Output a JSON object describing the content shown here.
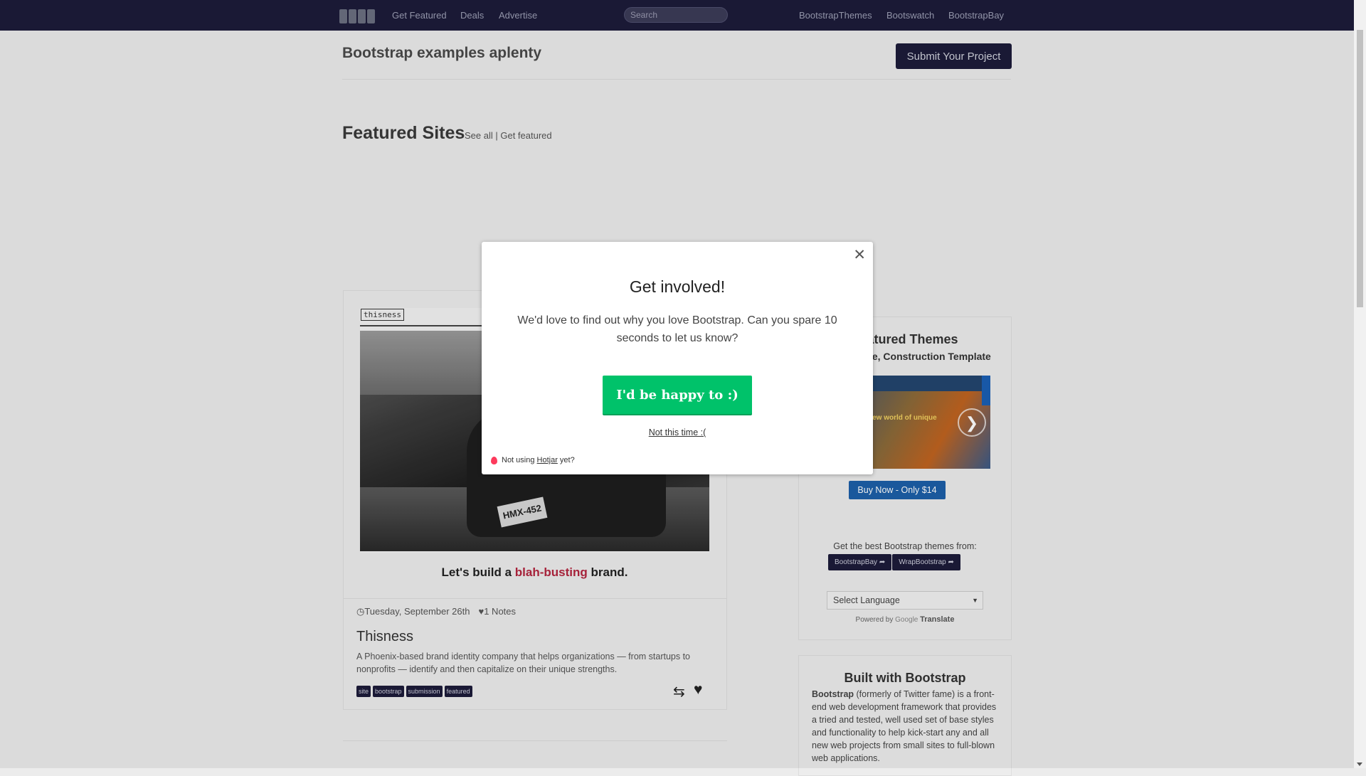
{
  "nav": {
    "links": [
      "Get Featured",
      "Deals",
      "Advertise"
    ],
    "search_placeholder": "Search",
    "right_links": [
      "BootstrapThemes",
      "Bootswatch",
      "BootstrapBay"
    ]
  },
  "header": {
    "title": "Bootstrap examples aplenty",
    "submit_label": "Submit Your Project"
  },
  "featured": {
    "title": "Featured Sites",
    "links": "See all | Get featured"
  },
  "post": {
    "thumb_tag": "thisness",
    "tagline_pre": "Let's build a ",
    "tagline_hl": "blah-busting",
    "tagline_post": " brand.",
    "plate": "HMX-452",
    "date": "Tuesday, September 26th",
    "notes": "1 Notes",
    "title": "Thisness",
    "description": "A Phoenix-based brand identity company that helps organizations — from startups to nonprofits — identify and then capitalize on their unique strengths.",
    "tags": [
      "site",
      "bootstrap",
      "submission",
      "featured"
    ]
  },
  "sidebar": {
    "heading": "Featured Themes",
    "subheading": "Architecture, Construction Template",
    "theme_img_text": "new world of unique",
    "buy_label": "Buy Now - Only $14",
    "get_best": "Get the best Bootstrap themes from:",
    "theme_buttons": [
      "BootstrapBay",
      "WrapBootstrap"
    ],
    "language": "Select Language",
    "powered_by": "Powered by",
    "google": "Google",
    "translate": "Translate",
    "built_heading": "Built with Bootstrap",
    "built_strong": "Bootstrap",
    "built_text": " (formerly of Twitter fame) is a front-end web development framework that provides a tried and tested, well used set of base styles and functionality to help kick-start any and all new web projects from small sites to full-blown web applications."
  },
  "modal": {
    "title": "Get involved!",
    "text": "We'd love to find out why you love Bootstrap. Can you spare 10 seconds to let us know?",
    "cta": "I'd be happy to :)",
    "decline": "Not this time :(",
    "footer_pre": "Not using ",
    "footer_link": "Hotjar",
    "footer_post": " yet?"
  },
  "colors": {
    "navbar": "#1c1b3a",
    "cta_green": "#00c26a",
    "buy_blue": "#1c5fa8"
  }
}
